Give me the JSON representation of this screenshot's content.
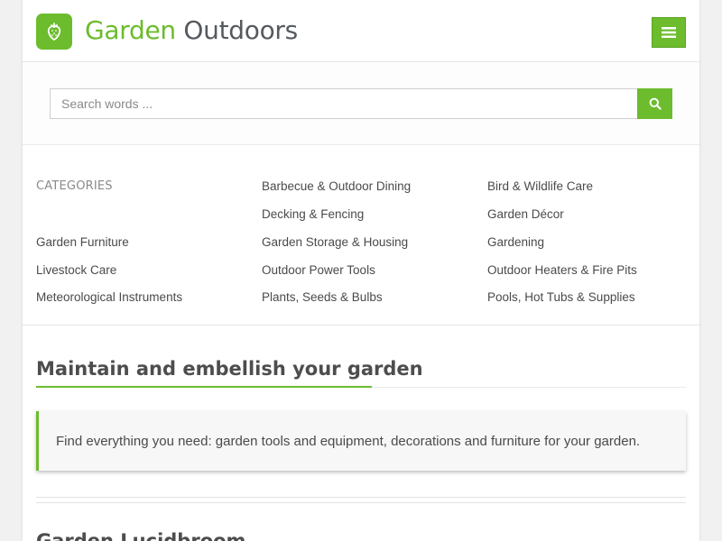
{
  "header": {
    "logo_icon": "strawberry-icon",
    "title_part1": "Garden",
    "title_part2": " Outdoors",
    "menu_icon": "hamburger-icon"
  },
  "search": {
    "placeholder": "Search words ...",
    "value": "",
    "button_icon": "search-icon"
  },
  "categories": {
    "heading": "CATEGORIES",
    "items": [
      "Barbecue & Outdoor Dining",
      "Bird & Wildlife Care",
      "Decking & Fencing",
      "Garden Décor",
      "Garden Furniture",
      "Garden Storage & Housing",
      "Gardening",
      "Livestock Care",
      "Outdoor Power Tools",
      "Outdoor Heaters & Fire Pits",
      "Meteorological Instruments",
      "Plants, Seeds & Bulbs",
      "Pools, Hot Tubs & Supplies"
    ]
  },
  "main": {
    "section_title": "Maintain and embellish your garden",
    "callout_text": "Find everything you need: garden tools and equipment, decorations and furniture for your garden.",
    "next_title": "Garden Lucidbroom"
  },
  "colors": {
    "accent": "#6cbc2d",
    "text": "#4a4a4a"
  }
}
